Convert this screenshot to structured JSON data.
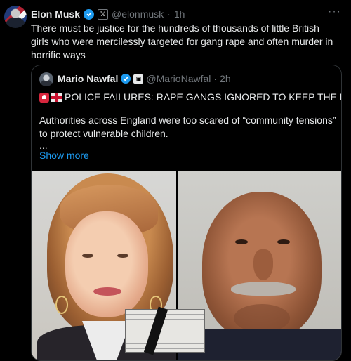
{
  "tweet": {
    "author_name": "Elon Musk",
    "author_handle": "@elonmusk",
    "separator": "·",
    "time": "1h",
    "more": "···",
    "text": "There must be justice for the hundreds of thousands of little British girls who were mercilessly targeted for gang rape and often murder in horrific ways",
    "affiliate_badge": "𝕏"
  },
  "quote": {
    "author_name": "Mario Nawfal",
    "author_handle": "@MarioNawfal",
    "separator": "·",
    "time": "2h",
    "headline": "POLICE FAILURES: RAPE GANGS IGNORED TO KEEP THE PEACE",
    "body": "Authorities across England were too scared of “community tensions” to protect vulnerable children.",
    "ellipsis": "...",
    "show_more": "Show more"
  },
  "colors": {
    "background": "#000000",
    "text": "#e7e9ea",
    "muted": "#71767b",
    "accent": "#1d9bf0",
    "border": "#2f3336"
  }
}
